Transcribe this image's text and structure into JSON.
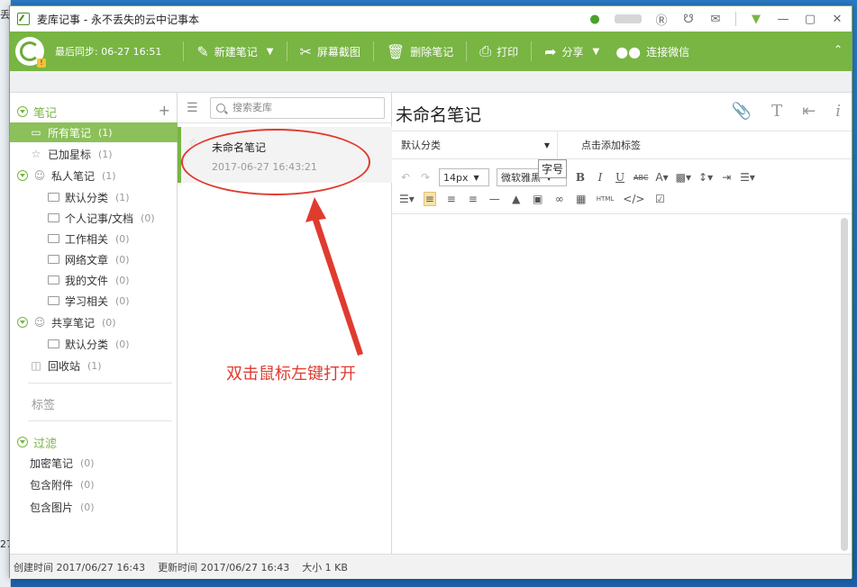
{
  "window": {
    "title": "麦库记事 - 永不丢失的云中记事本"
  },
  "desktop": {
    "fragments": [
      "丢",
      "27"
    ]
  },
  "toolbar": {
    "sync": "最后同步: 06-27 16:51",
    "new_note": "新建笔记",
    "screenshot": "屏幕截图",
    "delete": "删除笔记",
    "print": "打印",
    "share": "分享",
    "wechat": "连接微信"
  },
  "sidebar": {
    "notes_header": "笔记",
    "items": [
      {
        "label": "所有笔记",
        "count": "(1)"
      },
      {
        "label": "已加星标",
        "count": "(1)"
      },
      {
        "label": "私人笔记",
        "count": "(1)"
      },
      {
        "label": "默认分类",
        "count": "(1)"
      },
      {
        "label": "个人记事/文档",
        "count": "(0)"
      },
      {
        "label": "工作相关",
        "count": "(0)"
      },
      {
        "label": "网络文章",
        "count": "(0)"
      },
      {
        "label": "我的文件",
        "count": "(0)"
      },
      {
        "label": "学习相关",
        "count": "(0)"
      },
      {
        "label": "共享笔记",
        "count": "(0)"
      },
      {
        "label": "默认分类",
        "count": "(0)"
      },
      {
        "label": "回收站",
        "count": "(1)"
      }
    ],
    "tags_header": "标签",
    "filter_header": "过滤",
    "filters": [
      {
        "label": "加密笔记",
        "count": "(0)"
      },
      {
        "label": "包含附件",
        "count": "(0)"
      },
      {
        "label": "包含图片",
        "count": "(0)"
      }
    ]
  },
  "notelist": {
    "search_placeholder": "搜索麦库",
    "note": {
      "title": "未命名笔记",
      "date": "2017-06-27 16:43:21"
    }
  },
  "annotation": "双击鼠标左键打开",
  "editor": {
    "title": "未命名笔记",
    "category": "默认分类",
    "tags_placeholder": "点击添加标签",
    "font_size": "14px",
    "font_family": "微软雅黑",
    "tooltip": "字号",
    "abc": "ABC",
    "html": "HTML"
  },
  "status": {
    "created": "创建时间 2017/06/27 16:43",
    "updated": "更新时间 2017/06/27 16:43",
    "size": "大小 1 KB"
  }
}
